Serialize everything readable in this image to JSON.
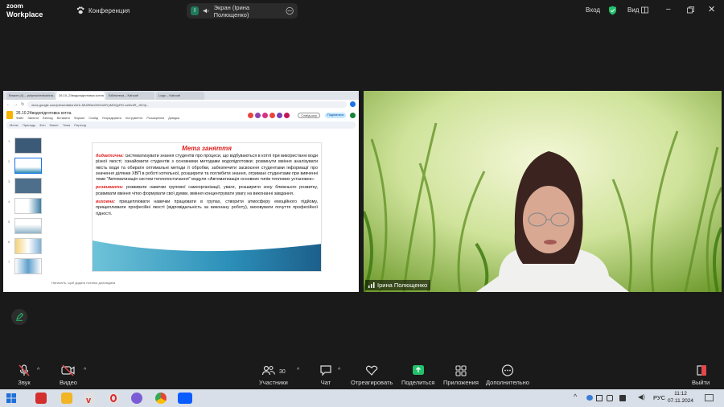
{
  "app": {
    "logo_line1": "zoom",
    "logo_line2": "Workplace",
    "conference_label": "Конференция"
  },
  "screen_share": {
    "number": "I",
    "label": "Экран (Ірина Полющенко)"
  },
  "top_right": {
    "enter": "Вход",
    "view": "Вид"
  },
  "browser": {
    "tabs": [
      "Власні (4) – polynschenkoirina...",
      "26.10_24водопідготовка котла",
      "Бібліотека – Kahoot!",
      "Logo – Kahoot!"
    ],
    "url": "docs.google.com/presentation/d/1r-MUi9Nm0lXGa0tYyMOQyRG-sxNv4R_JiChlj...",
    "doc_title": "26.10.24водопідготовка котла",
    "menus": [
      "Файл",
      "Змінити",
      "Вигляд",
      "Вставити",
      "Формат",
      "Слайд",
      "Упорядкувати",
      "Інструменти",
      "Розширення",
      "Довідка"
    ],
    "toolbar": [
      "Меню",
      "Приладу",
      "Фон",
      "Макет",
      "Тема",
      "Перехід"
    ],
    "slideshow_label": "Слайд-шоу",
    "share_label": "Поділитися",
    "thumb_numbers": [
      "1",
      "2",
      "3",
      "4",
      "5",
      "6",
      "7"
    ],
    "notes_placeholder": "Натисніть, щоб додати нотатки доповідача"
  },
  "slide": {
    "title": "Мета заняття",
    "p1_kw": "дидактична:",
    "p1": " систематизувати знання студентів про процеси, що відбуваються в котлі при використанні води різної якості; ознайомити студентів з основними методами водопідготовки; розвинути вміння аналізувати якість води та обирати оптимальні методи її обробки, забезпечити засвоєння студентами інформації про значення ділянки ХВП в роботі котельної, розширити та поглибити знання, отримані студентами при вивченні теми \"Автоматизація систем теплопостачання\" модуля «Автоматизація основних типів теплових установок».",
    "p2_kw": "розвиваюча:",
    "p2": " розвивати навички групової самоорганізації, уваги, розширити зону ближнього розвитку, розвивати вміння чітко формувати свої думки, вміння концентрувати увагу на виконанні завдання.",
    "p3_kw": "виховна:",
    "p3": " прищеплювати навички працювати в групах, створити атмосферу емоційного підйому, прищеплювати професійні якості (відповідальність за виконану роботу), виховувати почуття професійної гідності."
  },
  "video": {
    "participant_name": "Ірина Полющенко"
  },
  "bottom_bar": {
    "audio": "Звук",
    "video": "Видео",
    "participants": "Участники",
    "participants_count": "30",
    "chat": "Чат",
    "react": "Отреагировать",
    "share": "Поделиться",
    "apps": "Приложения",
    "more": "Дополнительно",
    "leave": "Выйти"
  },
  "taskbar": {
    "lang": "РУС",
    "time": "11:12",
    "date": "07.11.2024"
  },
  "colors": {
    "accent_red": "#e02020",
    "share_green": "#23c16b",
    "leave_red": "#e5474b",
    "zoom_blue": "#0b5cff"
  }
}
